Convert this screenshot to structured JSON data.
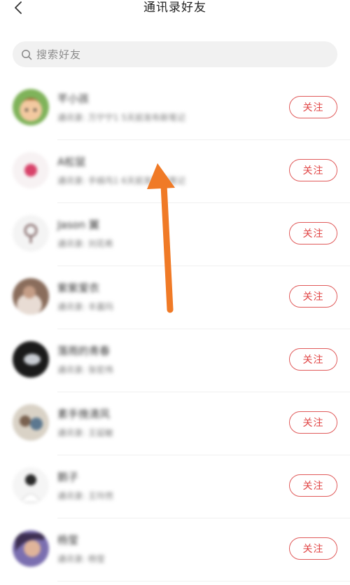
{
  "header": {
    "title": "通讯录好友"
  },
  "search": {
    "placeholder": "搜索好友"
  },
  "contacts": [
    {
      "name": "芊小孩",
      "subtitle": "通讯录: 万宁宁1 5天前发布新笔记",
      "follow_label": "关注",
      "avatar": "cartoon-avatar"
    },
    {
      "name": "A松鼠",
      "subtitle": "通讯录: 手绢鸟1 6天前发布新笔记",
      "follow_label": "关注",
      "avatar": "pink-icon-avatar"
    },
    {
      "name": "Jason 翼",
      "subtitle": "通讯录: 刘花希",
      "follow_label": "关注",
      "avatar": "pin-avatar"
    },
    {
      "name": "紫紫爱衣",
      "subtitle": "通讯录: 丰嘉玛",
      "follow_label": "关注",
      "avatar": "photo-avatar"
    },
    {
      "name": "落雨的青春",
      "subtitle": "通讯录: 张宏伟",
      "follow_label": "关注",
      "avatar": "dark-avatar"
    },
    {
      "name": "素手挽清风",
      "subtitle": "通讯录: 王延敏",
      "follow_label": "关注",
      "avatar": "group-avatar"
    },
    {
      "name": "鹅子",
      "subtitle": "通讯录: 王玲然",
      "follow_label": "关注",
      "avatar": "person-avatar"
    },
    {
      "name": "杨莹",
      "subtitle": "通讯录: 杨莹",
      "follow_label": "关注",
      "avatar": "portrait-avatar"
    }
  ],
  "colors": {
    "accent": "#e04444",
    "annotation_arrow": "#f07a26"
  }
}
